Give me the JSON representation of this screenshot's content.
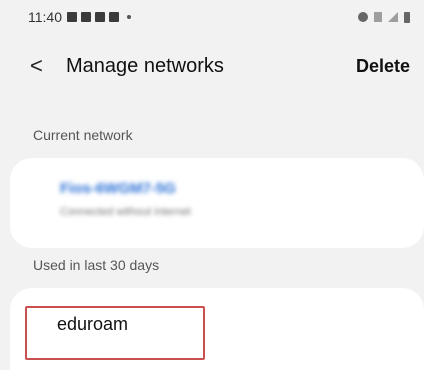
{
  "status_bar": {
    "time": "11:40",
    "notification_icons": [
      "picture-notification-icon",
      "flipboard-icon",
      "flipboard-icon",
      "flipboard-icon"
    ],
    "right_icons": [
      "alarm-icon",
      "wifi-icon",
      "signal-icon",
      "battery-icon"
    ]
  },
  "app_bar": {
    "back_glyph": "<",
    "title": "Manage networks",
    "delete_label": "Delete"
  },
  "sections": {
    "current_label": "Current network",
    "current_network": {
      "name": "Fios-6WGM7-5G",
      "status": "Connected without internet"
    },
    "used_label": "Used in last 30 days",
    "used_networks": [
      {
        "name": "eduroam"
      }
    ]
  },
  "colors": {
    "background": "#f2f2f2",
    "card": "#ffffff",
    "highlight": "#c9504e",
    "network_name": "#2a6fd6"
  }
}
